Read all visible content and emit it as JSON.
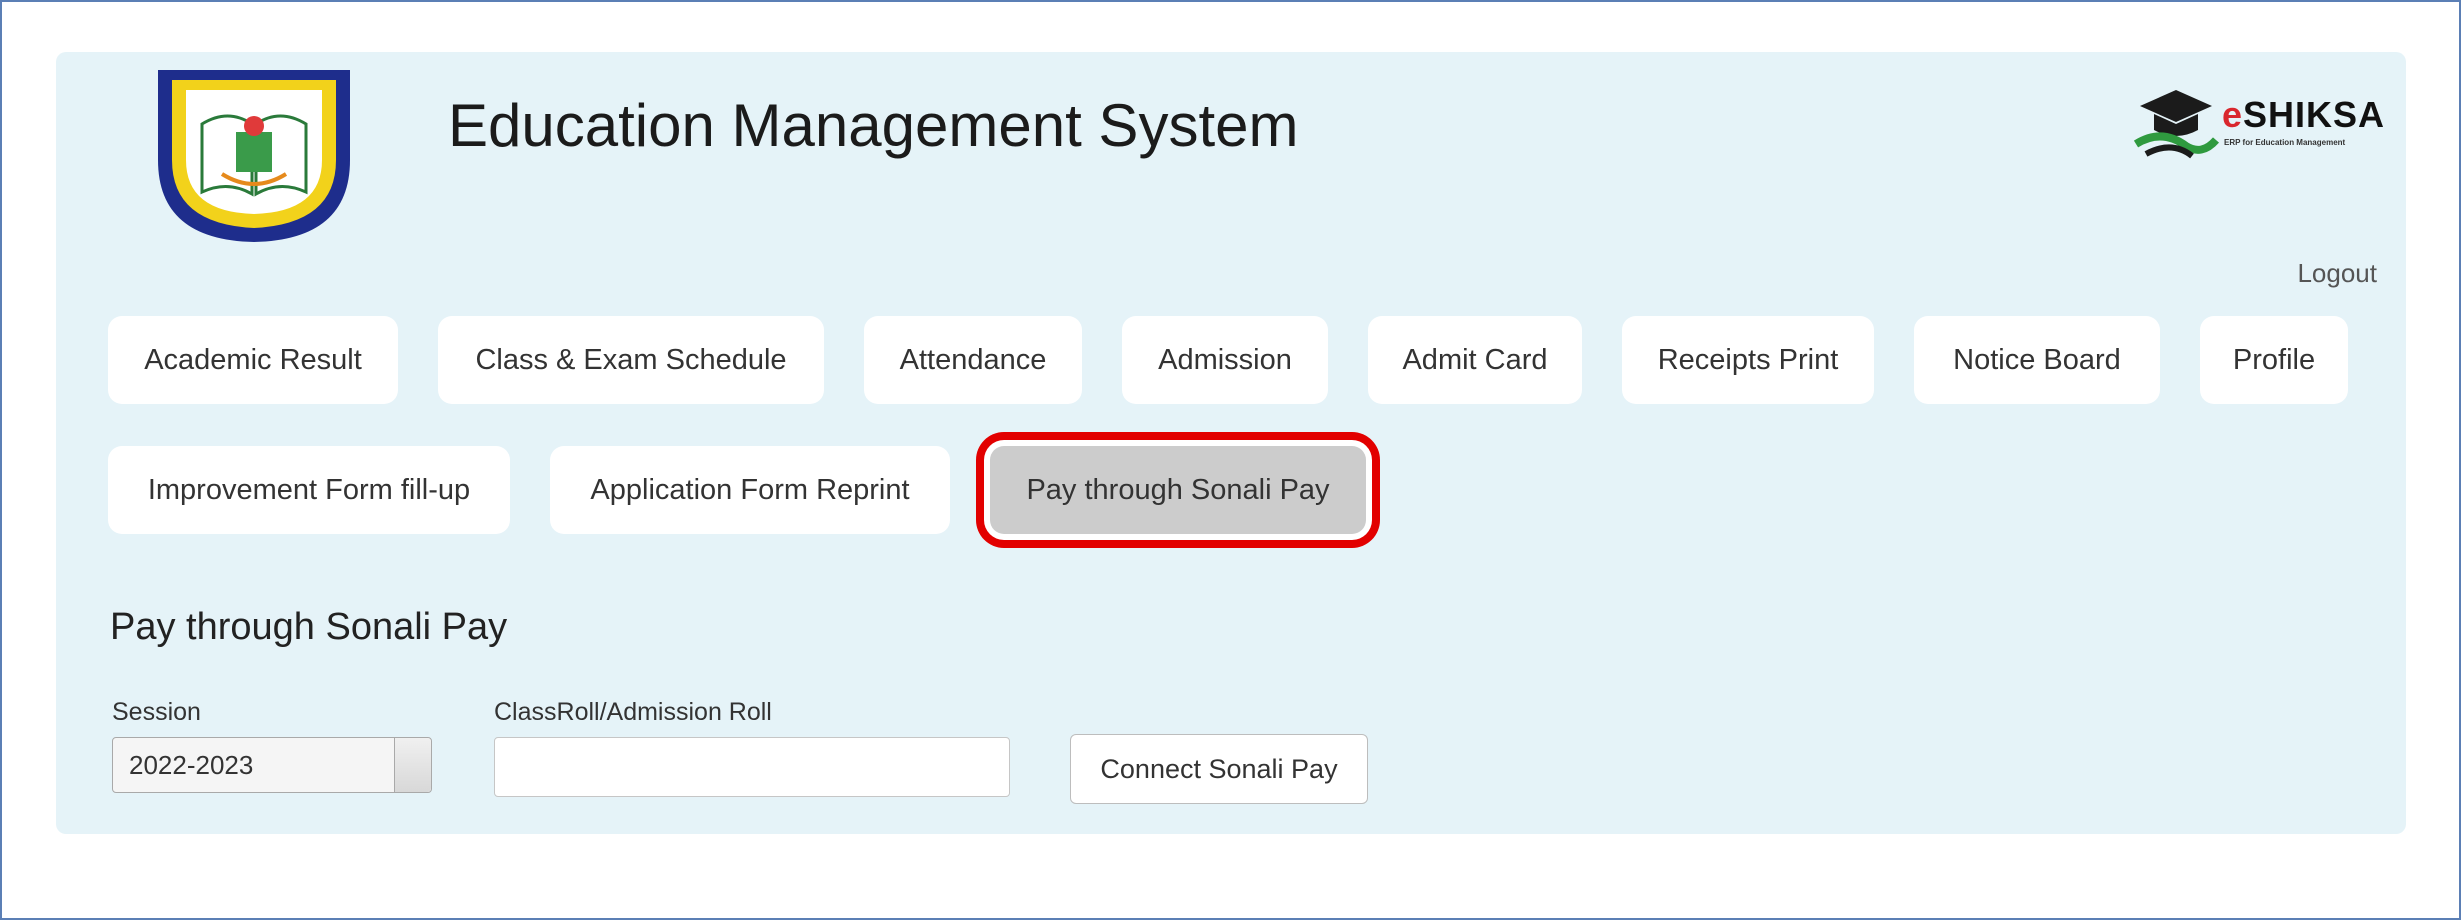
{
  "header": {
    "title": "Education Management System",
    "brand_name_e": "e",
    "brand_name_rest": "SHIKSA",
    "brand_tagline": "ERP for Education Management",
    "logout_label": "Logout"
  },
  "nav": {
    "row1": [
      {
        "label": "Academic Result"
      },
      {
        "label": "Class & Exam Schedule"
      },
      {
        "label": "Attendance"
      },
      {
        "label": "Admission"
      },
      {
        "label": "Admit Card"
      },
      {
        "label": "Receipts Print"
      },
      {
        "label": "Notice Board"
      },
      {
        "label": "Profile"
      }
    ],
    "row2": [
      {
        "label": "Improvement Form fill-up"
      },
      {
        "label": "Application Form Reprint"
      },
      {
        "label": "Pay through Sonali Pay",
        "active": true
      }
    ]
  },
  "form": {
    "section_title": "Pay through Sonali Pay",
    "session_label": "Session",
    "session_value": "2022-2023",
    "roll_label": "ClassRoll/Admission Roll",
    "roll_value": "",
    "connect_label": "Connect Sonali Pay"
  },
  "colors": {
    "panel_bg": "#e5f3f8",
    "highlight_border": "#e20000",
    "active_button_bg": "#cccccc",
    "logo_ring": "#1e2d8c"
  }
}
